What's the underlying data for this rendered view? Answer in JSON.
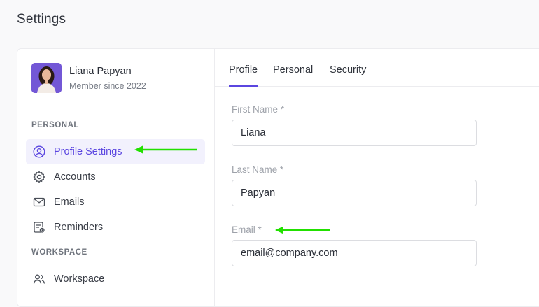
{
  "page": {
    "title": "Settings"
  },
  "profile": {
    "name": "Liana Papyan",
    "member_since": "Member since 2022",
    "avatar_icon": "user-avatar-photo"
  },
  "sidebar": {
    "sections": [
      {
        "label": "PERSONAL",
        "items": [
          {
            "label": "Profile Settings",
            "icon": "user-circle-icon",
            "active": true
          },
          {
            "label": "Accounts",
            "icon": "gear-icon",
            "active": false
          },
          {
            "label": "Emails",
            "icon": "mail-icon",
            "active": false
          },
          {
            "label": "Reminders",
            "icon": "reminder-icon",
            "active": false
          }
        ]
      },
      {
        "label": "WORKSPACE",
        "items": [
          {
            "label": "Workspace",
            "icon": "users-icon",
            "active": false
          }
        ]
      }
    ]
  },
  "tabs": [
    {
      "label": "Profile",
      "active": true
    },
    {
      "label": "Personal",
      "active": false
    },
    {
      "label": "Security",
      "active": false
    }
  ],
  "form": {
    "first_name": {
      "label": "First Name *",
      "value": "Liana"
    },
    "last_name": {
      "label": "Last Name *",
      "value": "Papyan"
    },
    "email": {
      "label": "Email *",
      "value": "email@company.com"
    }
  },
  "colors": {
    "accent": "#5b46e0",
    "active_bg": "#f2f1fd",
    "annotation_arrow": "#22e000"
  }
}
